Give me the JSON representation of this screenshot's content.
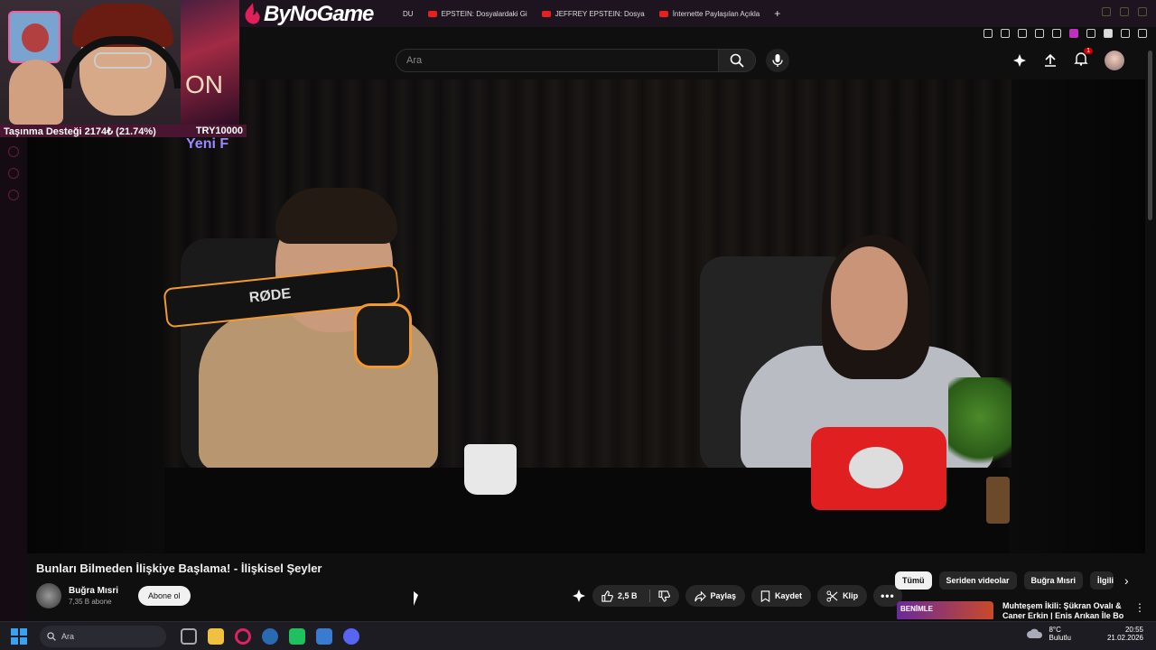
{
  "browser": {
    "tabs": [
      {
        "label": "DU"
      },
      {
        "label": "EPSTEIN: Dosyalardaki Gi"
      },
      {
        "label": "JEFFREY EPSTEIN: Dosya"
      },
      {
        "label": "İnternette Paylaşılan Açıkla"
      }
    ]
  },
  "overlay": {
    "logo": "ByNoGame",
    "donation_label": "Taşınma Desteği 2174₺ (21.74%)",
    "donation_goal": "TRY10000",
    "donation_progress": 21.74,
    "ticker": "Yeni F",
    "art_text": "ON"
  },
  "youtube": {
    "search_placeholder": "Ara",
    "notification_count": "1"
  },
  "video": {
    "mic_brand": "RØDE",
    "title": "Bunları Bilmeden İlişkiye Başlama! - İlişkisel Şeyler",
    "channel_name": "Buğra Mısri",
    "channel_subs": "7,35 B abone",
    "subscribe_label": "Abone ol",
    "likes": "2,5 B",
    "share_label": "Paylaş",
    "save_label": "Kaydet",
    "clip_label": "Klip"
  },
  "sidebar_chips": [
    {
      "label": "Tümü"
    },
    {
      "label": "Seriden videolar"
    },
    {
      "label": "Buğra Mısri"
    },
    {
      "label": "İlgili"
    }
  ],
  "related": {
    "thumb_text": "BENİMLE",
    "title": "Muhteşem İkili: Şükran Ovalı & Caner Erkin | Enis Arıkan İle Bo"
  },
  "taskbar": {
    "search_label": "Ara",
    "temperature": "8°C",
    "weather": "Bulutlu",
    "time": "20:55",
    "date": "21.02.2026"
  },
  "colors": {
    "accent": "#cc0000",
    "overlay_bar": "#4a1530",
    "mic_ring": "#f29a30"
  }
}
